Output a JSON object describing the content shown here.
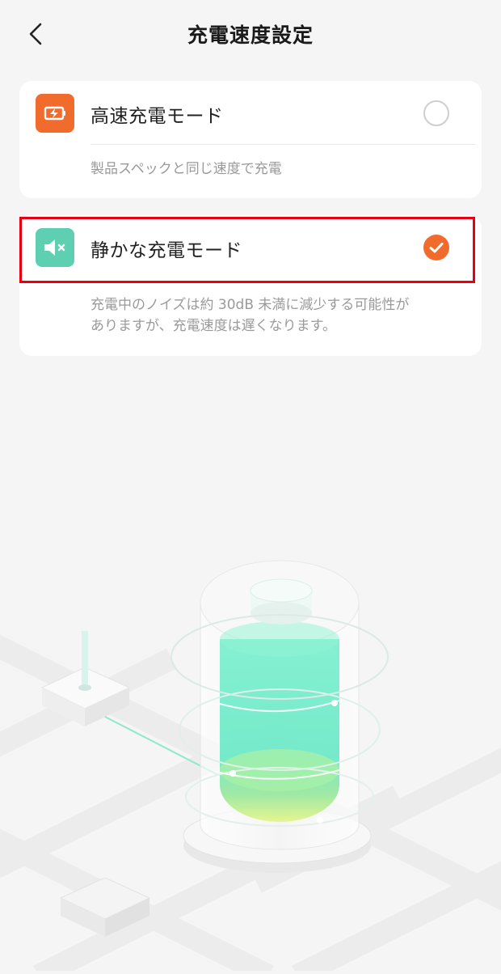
{
  "header": {
    "title": "充電速度設定",
    "back_icon": "chevron-left-icon"
  },
  "modes": [
    {
      "label": "高速充電モード",
      "description": "製品スペックと同じ速度で充電",
      "icon": "battery-bolt-icon",
      "icon_color": "#f06b2c",
      "selected": false
    },
    {
      "label": "静かな充電モード",
      "description_line1": "充電中のノイズは約 30dB 未満に減少する可能性が",
      "description_line2": "ありますが、充電速度は遅くなります。",
      "icon": "speaker-mute-icon",
      "icon_color": "#5fcfb2",
      "selected": true
    }
  ],
  "colors": {
    "accent": "#f06b2c",
    "highlight_border": "#e60012",
    "quiet_green": "#5fcfb2"
  }
}
